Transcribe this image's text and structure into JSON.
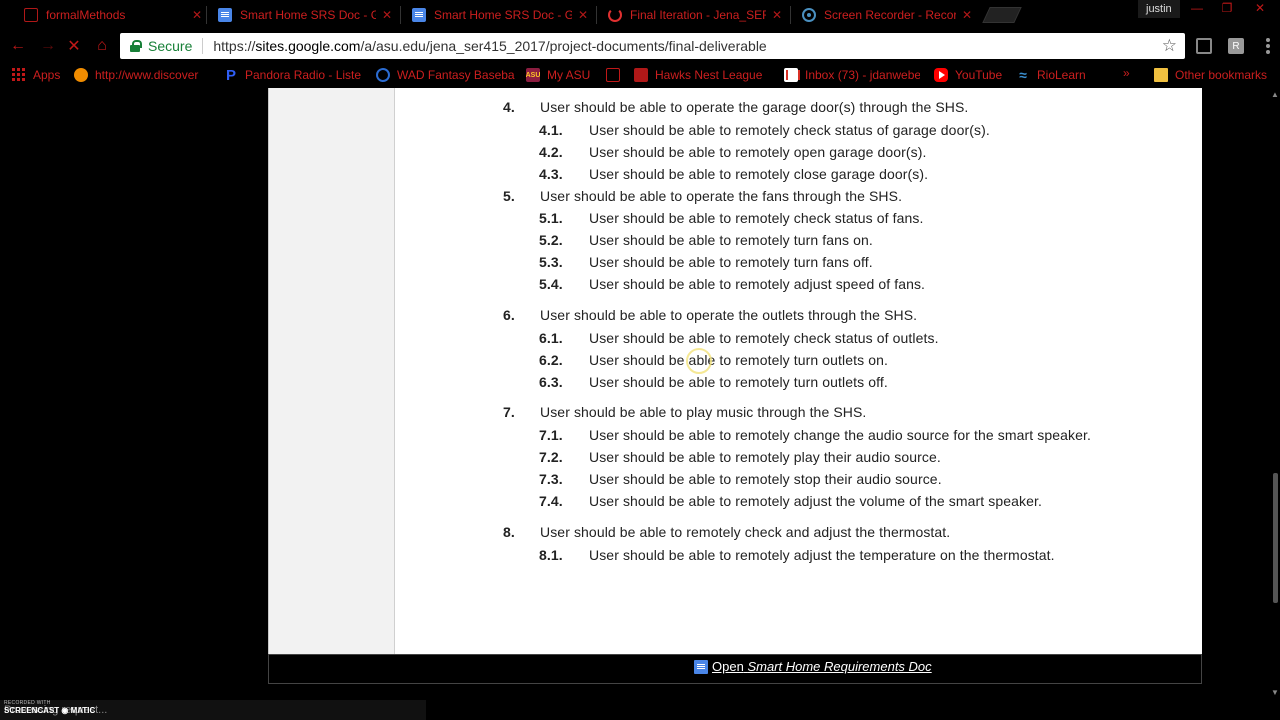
{
  "tabs": [
    {
      "title": "formalMethods",
      "icon": "red-square-icon"
    },
    {
      "title": "Smart Home SRS Doc - G",
      "icon": "google-docs-icon"
    },
    {
      "title": "Smart Home SRS Doc - G",
      "icon": "google-docs-icon"
    },
    {
      "title": "Final Iteration - Jena_SER",
      "icon": "loading-spinner-icon"
    },
    {
      "title": "Screen Recorder - Recor",
      "icon": "record-icon"
    }
  ],
  "profile_name": "justin",
  "omnibox": {
    "secure_label": "Secure",
    "url_scheme": "https://",
    "url_host": "sites.google.com",
    "url_path": "/a/asu.edu/jena_ser415_2017/project-documents/final-deliverable"
  },
  "bookmarks": [
    {
      "label": "Apps",
      "icon": "apps-grid-icon"
    },
    {
      "label": "http://www.discover",
      "icon": "discover-icon"
    },
    {
      "label": "Pandora Radio - Liste",
      "icon": "pandora-icon"
    },
    {
      "label": "WAD Fantasy Baseba",
      "icon": "cbs-eye-icon"
    },
    {
      "label": "My ASU",
      "icon": "asu-icon"
    },
    {
      "label": "",
      "icon": "page-icon"
    },
    {
      "label": "Hawks Nest League",
      "icon": "hawks-icon"
    },
    {
      "label": "Inbox (73) - jdanwebe",
      "icon": "gmail-icon"
    },
    {
      "label": "YouTube",
      "icon": "youtube-icon"
    },
    {
      "label": "RioLearn",
      "icon": "riolearn-icon"
    }
  ],
  "bookmarks_more": "»",
  "other_bookmarks": "Other bookmarks",
  "requirements": [
    {
      "num": "4.",
      "text": "User should be able to operate the garage door(s) through the SHS.",
      "subs": [
        {
          "num": "4.1.",
          "text": "User should be able to remotely check status of garage door(s)."
        },
        {
          "num": "4.2.",
          "text": "User should be able to remotely open garage door(s)."
        },
        {
          "num": "4.3.",
          "text": "User should be able to remotely close garage door(s)."
        }
      ]
    },
    {
      "num": "5.",
      "text": "User should be able to operate the fans through the SHS.",
      "subs": [
        {
          "num": "5.1.",
          "text": "User should be able to remotely check status of fans."
        },
        {
          "num": "5.2.",
          "text": "User should be able to remotely turn fans on."
        },
        {
          "num": "5.3.",
          "text": "User should be able to remotely turn fans off."
        },
        {
          "num": "5.4.",
          "text": "User should be able to remotely adjust speed of fans."
        }
      ]
    },
    {
      "num": "6.",
      "text": "User should be able to operate the outlets through the SHS.",
      "subs": [
        {
          "num": "6.1.",
          "text": "User should be able to remotely check status of outlets."
        },
        {
          "num": "6.2.",
          "text": "User should be able to remotely turn outlets on."
        },
        {
          "num": "6.3.",
          "text": "User should be able to remotely turn outlets off."
        }
      ]
    },
    {
      "num": "7.",
      "text": "User should be able to play music through the SHS.",
      "subs": [
        {
          "num": "7.1.",
          "text": "User should be able to remotely change the audio source for the smart speaker."
        },
        {
          "num": "7.2.",
          "text": "User should be able to remotely play their audio source."
        },
        {
          "num": "7.3.",
          "text": "User should be able to remotely stop their audio source."
        },
        {
          "num": "7.4.",
          "text": "User should be able to remotely adjust the volume of the smart speaker."
        }
      ]
    },
    {
      "num": "8.",
      "text": "User should be able to remotely check and adjust the thermostat.",
      "subs": [
        {
          "num": "8.1.",
          "text": "User should be able to remotely adjust the temperature on the thermostat."
        }
      ]
    }
  ],
  "footer_link": {
    "prefix": "Open",
    "doc_name": "Smart Home Requirements Doc"
  },
  "status_text": "Processing request...",
  "watermark_top": "RECORDED WITH",
  "watermark_brand": "SCREENCAST",
  "watermark_brand_suffix": "MATIC"
}
